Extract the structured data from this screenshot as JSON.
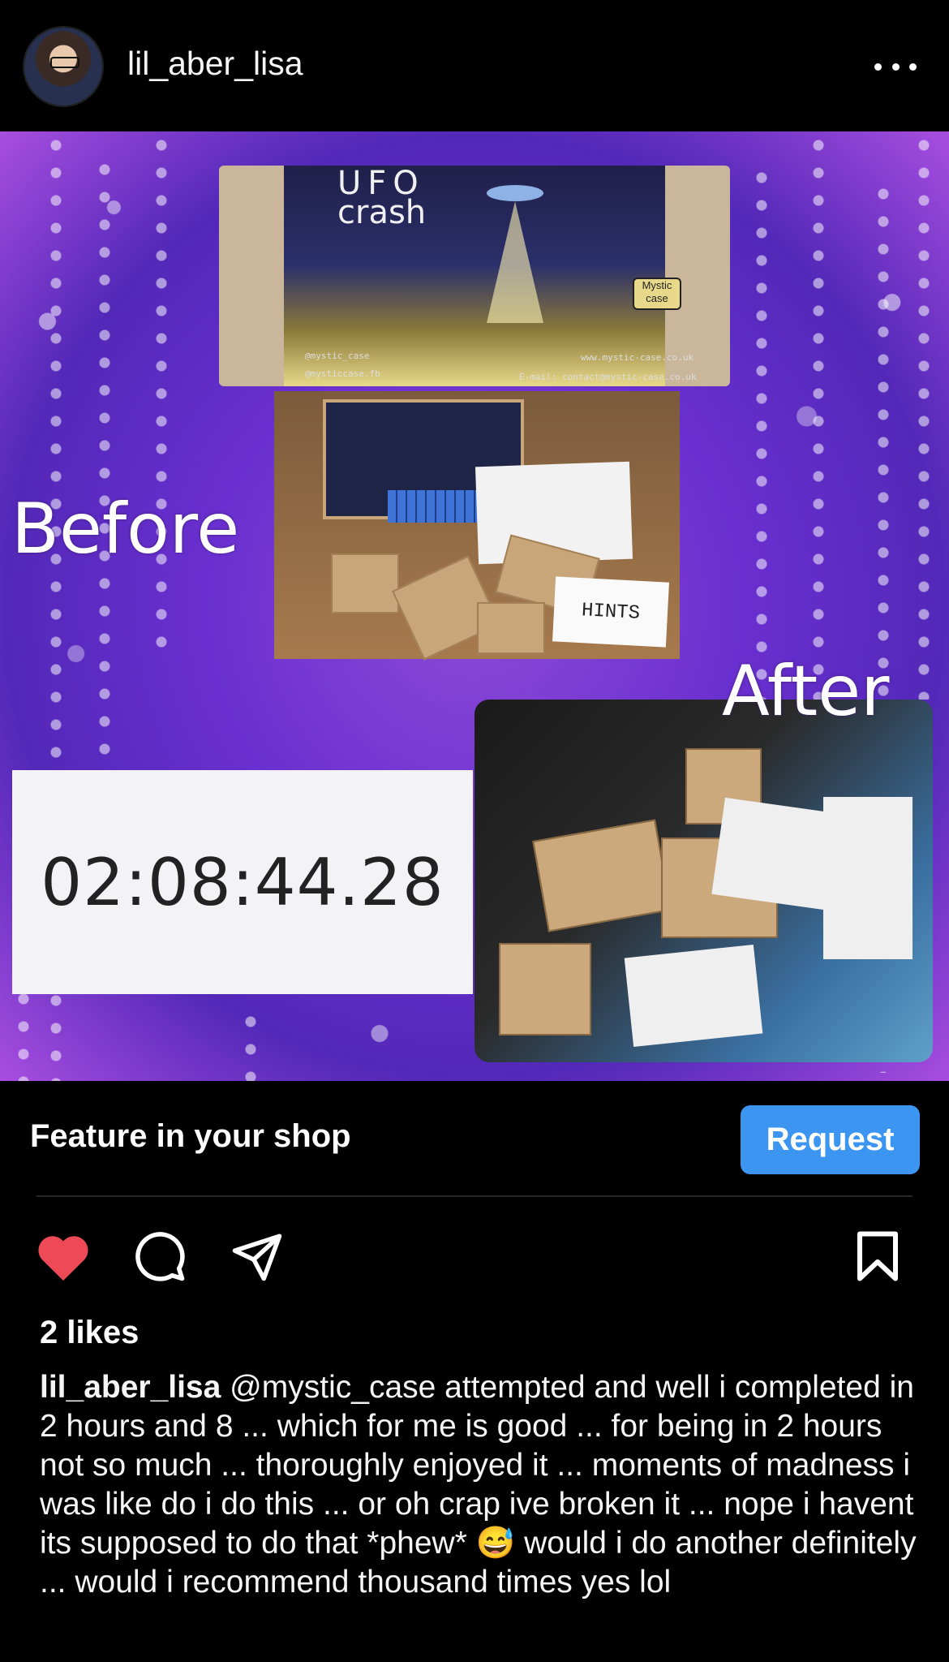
{
  "post": {
    "username": "lil_aber_lisa",
    "more_label": "More options"
  },
  "media": {
    "ufo_title_line1": "UFO",
    "ufo_title_line2": "crash",
    "ufo_instagram": "@mystic_case",
    "ufo_facebook": "@mysticcase.fb",
    "ufo_website": "www.mystic-case.co.uk",
    "ufo_email": "E-mail: contact@mystic-case.co.uk",
    "ufo_brand": "Mystic case",
    "hints_label": "HINTS",
    "before_label": "Before",
    "after_label": "After",
    "timer_value": "02:08:44.28"
  },
  "shop": {
    "label": "Feature in your shop",
    "button_label": "Request"
  },
  "engagement": {
    "likes": "2 likes",
    "liked": true,
    "colors": {
      "heart": "#ed4956",
      "button": "#3d95f2"
    }
  },
  "caption": {
    "username": "lil_aber_lisa",
    "text": "@mystic_case attempted and well i completed in 2 hours and 8 ... which for me is good ... for being in 2 hours not so much ... thoroughly enjoyed it ... moments of madness i was like do i do this ... or oh crap ive broken it ... nope i havent its supposed to do that *phew* 😅 would i do another definitely ... would i recommend thousand times yes lol"
  }
}
